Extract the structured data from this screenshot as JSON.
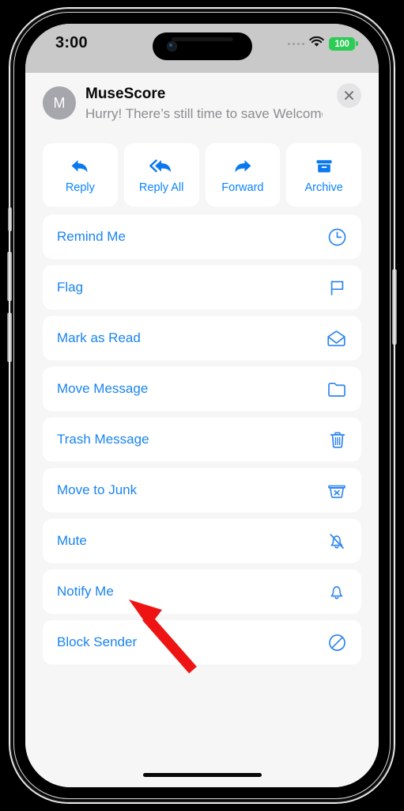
{
  "status_bar": {
    "time": "3:00",
    "battery_level": "100",
    "battery_color": "#2ccc55",
    "wifi_icon": "wifi-icon",
    "signal_icon": "signal-dots-icon"
  },
  "message": {
    "avatar_initial": "M",
    "sender": "MuseScore",
    "preview": "Hurry! There’s still time to save Welcome…",
    "close_icon": "close-icon"
  },
  "accent_color": "#0a84ff",
  "quick_actions": [
    {
      "label": "Reply",
      "icon": "reply-icon"
    },
    {
      "label": "Reply All",
      "icon": "reply-all-icon"
    },
    {
      "label": "Forward",
      "icon": "forward-icon"
    },
    {
      "label": "Archive",
      "icon": "archive-icon"
    }
  ],
  "menu_rows": [
    {
      "label": "Remind Me",
      "icon": "clock-icon"
    },
    {
      "label": "Flag",
      "icon": "flag-icon"
    },
    {
      "label": "Mark as Read",
      "icon": "envelope-open-icon"
    },
    {
      "label": "Move Message",
      "icon": "folder-icon"
    },
    {
      "label": "Trash Message",
      "icon": "trash-icon"
    },
    {
      "label": "Move to Junk",
      "icon": "junk-bin-icon"
    },
    {
      "label": "Mute",
      "icon": "bell-slash-icon"
    },
    {
      "label": "Notify Me",
      "icon": "bell-icon"
    },
    {
      "label": "Block Sender",
      "icon": "block-circle-icon"
    }
  ],
  "annotation": {
    "arrow_color": "#ee1414",
    "points_to": "Notify Me"
  }
}
